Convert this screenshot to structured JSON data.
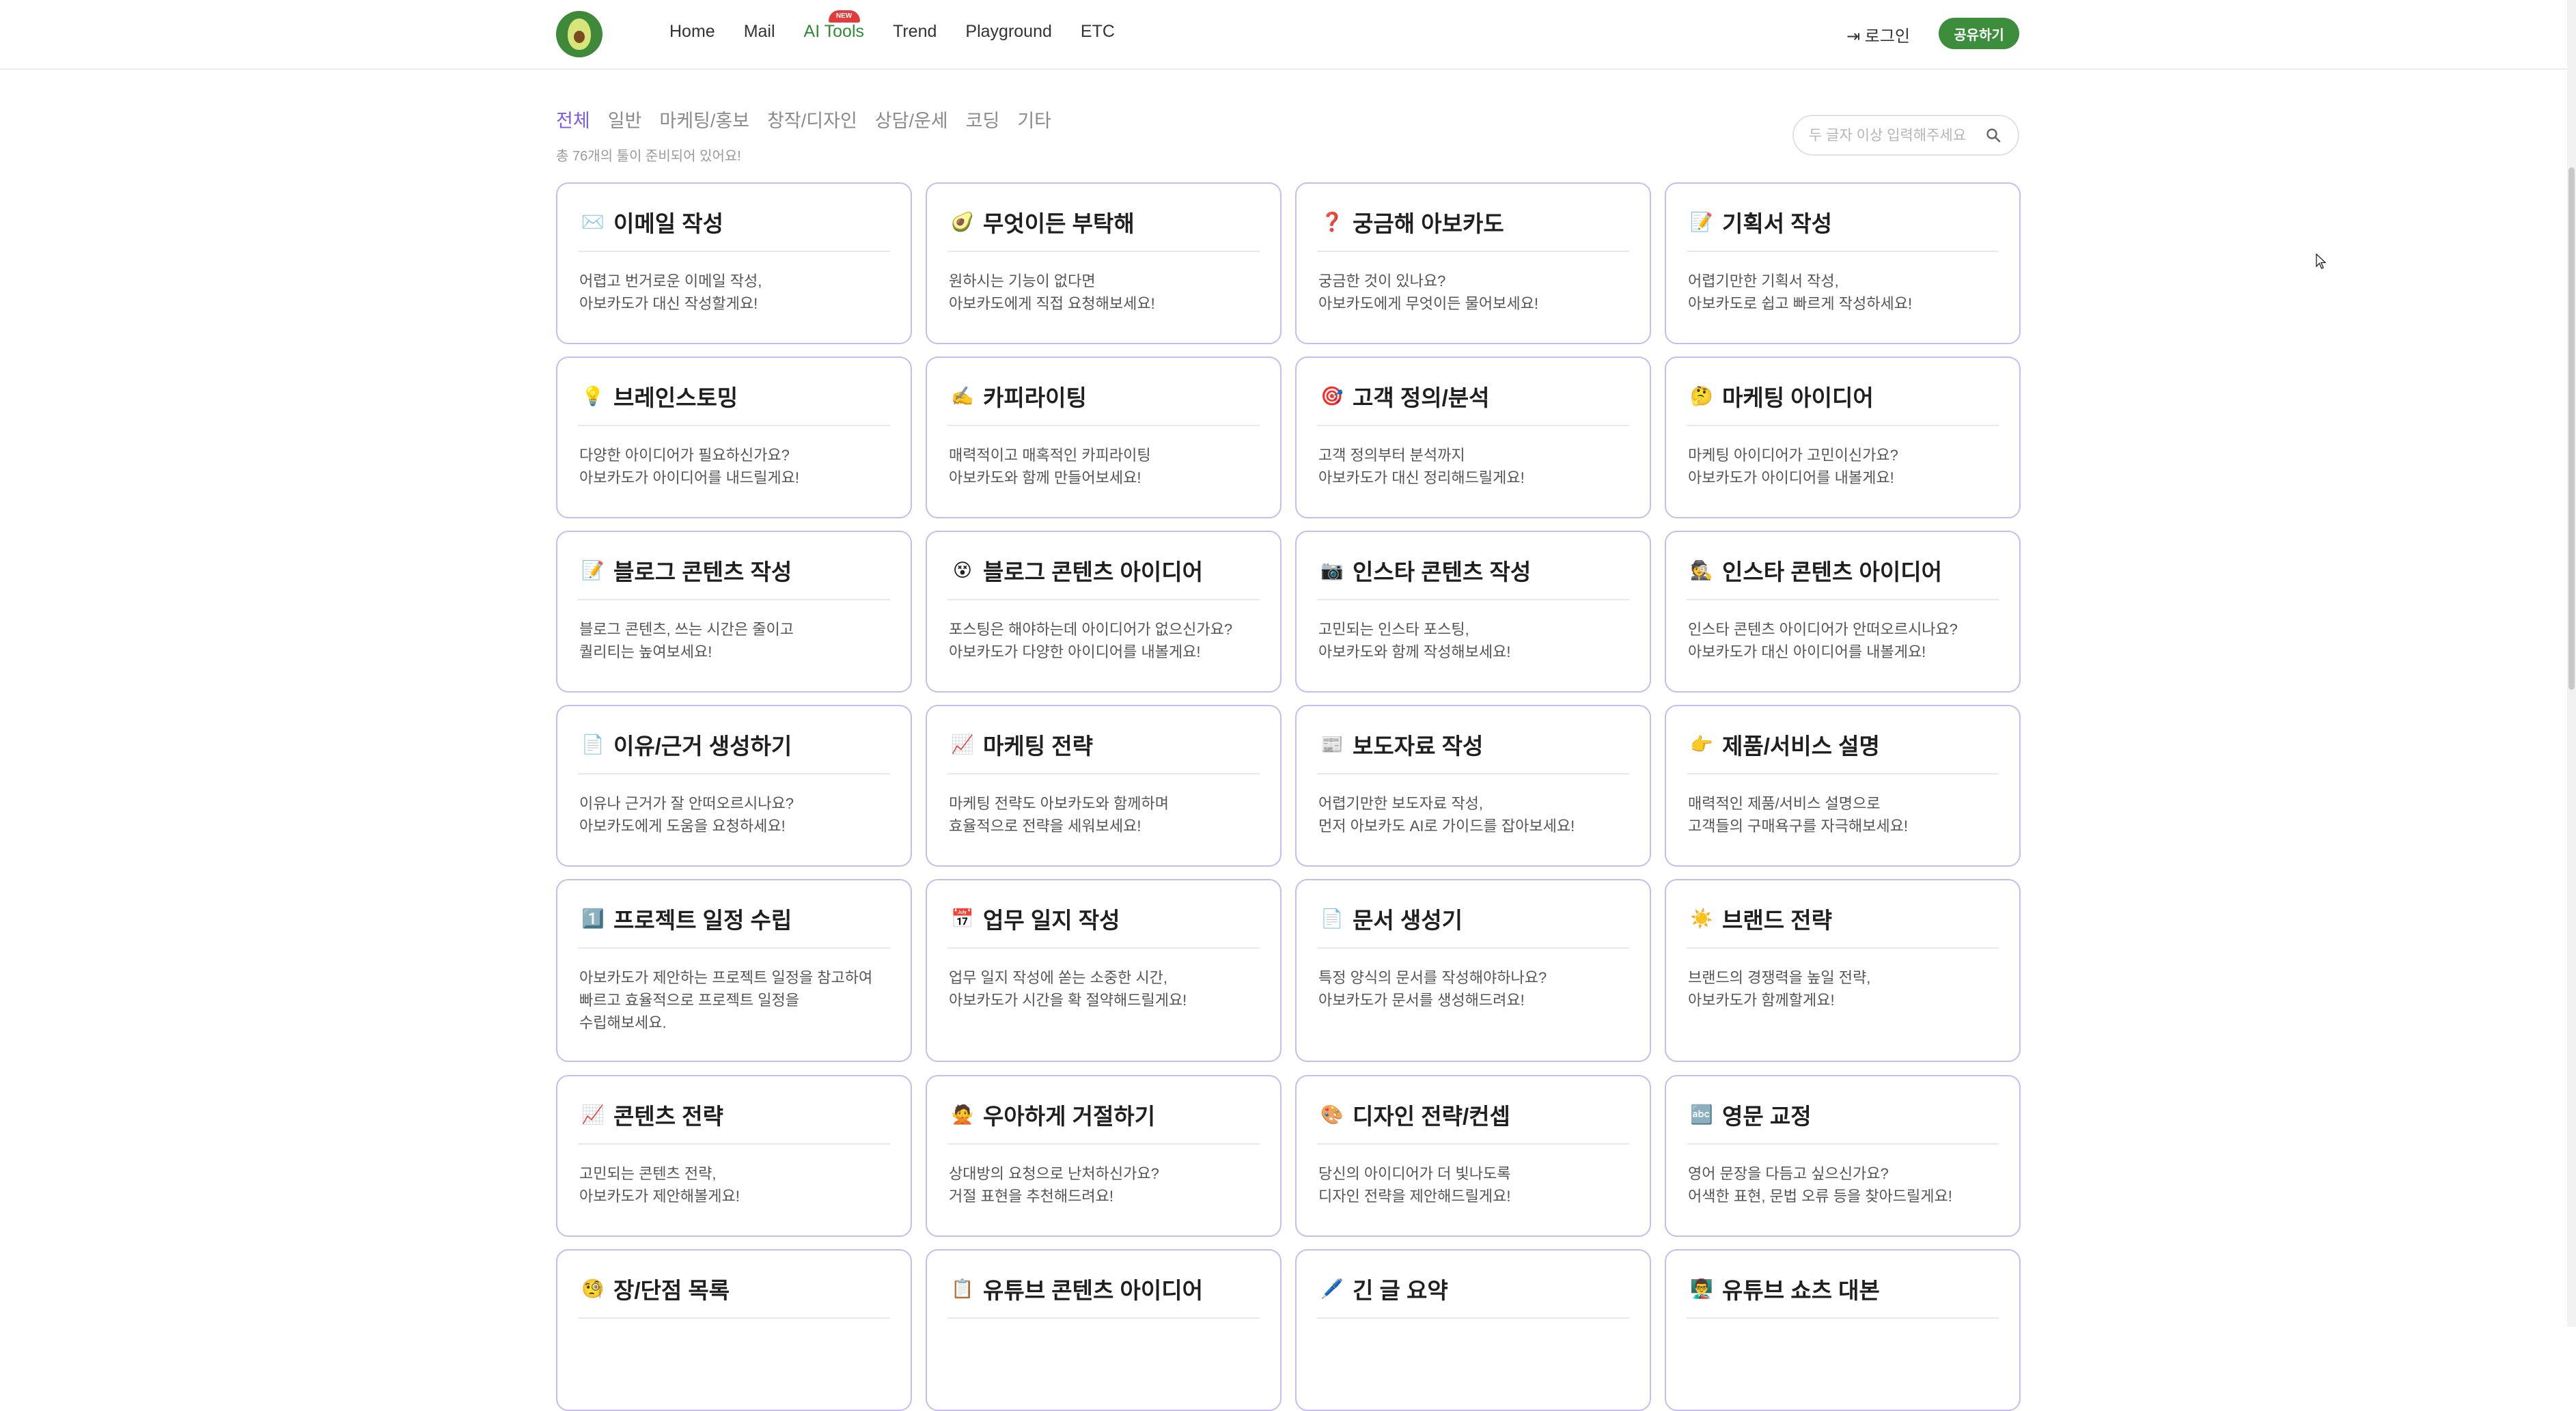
{
  "header": {
    "logo_alt": "avocado-logo",
    "nav": [
      {
        "label": "Home"
      },
      {
        "label": "Mail"
      },
      {
        "label": "AI Tools",
        "badge": "NEW"
      },
      {
        "label": "Trend"
      },
      {
        "label": "Playground"
      },
      {
        "label": "ETC"
      }
    ],
    "login": "⇥ 로그인",
    "share": "공유하기"
  },
  "filters": {
    "tabs": [
      "전체",
      "일반",
      "마케팅/홍보",
      "창작/디자인",
      "상담/운세",
      "코딩",
      "기타"
    ],
    "active": "전체",
    "count": "총 76개의 툴이 준비되어 있어요!"
  },
  "search": {
    "placeholder": "두 글자 이상 입력해주세요"
  },
  "accent": "#7b5cf0",
  "brand": "#3c8d3c",
  "cards": [
    {
      "icon": "✉️",
      "title": "이메일 작성",
      "desc": [
        "어렵고 번거로운 이메일 작성,",
        "아보카도가 대신 작성할게요!"
      ]
    },
    {
      "icon": "🥑",
      "title": "무엇이든 부탁해",
      "desc": [
        "원하시는 기능이 없다면",
        "아보카도에게 직접 요청해보세요!"
      ]
    },
    {
      "icon": "❓",
      "title": "궁금해 아보카도",
      "desc": [
        "궁금한 것이 있나요?",
        "아보카도에게 무엇이든 물어보세요!"
      ]
    },
    {
      "icon": "📝",
      "title": "기획서 작성",
      "desc": [
        "어렵기만한 기획서 작성,",
        "아보카도로 쉽고 빠르게 작성하세요!"
      ]
    },
    {
      "icon": "💡",
      "title": "브레인스토밍",
      "desc": [
        "다양한 아이디어가 필요하신가요?",
        "아보카도가 아이디어를 내드릴게요!"
      ]
    },
    {
      "icon": "✍️",
      "title": "카피라이팅",
      "desc": [
        "매력적이고 매혹적인 카피라이팅",
        "아보카도와 함께 만들어보세요!"
      ]
    },
    {
      "icon": "🎯",
      "title": "고객 정의/분석",
      "desc": [
        "고객 정의부터 분석까지",
        "아보카도가 대신 정리해드릴게요!"
      ]
    },
    {
      "icon": "🤔",
      "title": "마케팅 아이디어",
      "desc": [
        "마케팅 아이디어가 고민이신가요?",
        "아보카도가 아이디어를 내볼게요!"
      ]
    },
    {
      "icon": "📝",
      "title": "블로그 콘텐츠 작성",
      "desc": [
        "블로그 콘텐츠, 쓰는 시간은 줄이고",
        "퀄리티는 높여보세요!"
      ]
    },
    {
      "icon": "😵",
      "title": "블로그 콘텐츠 아이디어",
      "desc": [
        "포스팅은 해야하는데 아이디어가 없으신가요?",
        "아보카도가 다양한 아이디어를 내볼게요!"
      ]
    },
    {
      "icon": "📷",
      "title": "인스타 콘텐츠 작성",
      "desc": [
        "고민되는 인스타 포스팅,",
        "아보카도와 함께 작성해보세요!"
      ]
    },
    {
      "icon": "🕵️",
      "title": "인스타 콘텐츠 아이디어",
      "desc": [
        "인스타 콘텐츠 아이디어가 안떠오르시나요?",
        "아보카도가 대신 아이디어를 내볼게요!"
      ]
    },
    {
      "icon": "📄",
      "title": "이유/근거 생성하기",
      "desc": [
        "이유나 근거가 잘 안떠오르시나요?",
        "아보카도에게 도움을 요청하세요!"
      ]
    },
    {
      "icon": "📈",
      "title": "마케팅 전략",
      "desc": [
        "마케팅 전략도 아보카도와 함께하며",
        "효율적으로 전략을 세워보세요!"
      ]
    },
    {
      "icon": "📰",
      "title": "보도자료 작성",
      "desc": [
        "어렵기만한 보도자료 작성,",
        "먼저 아보카도 AI로 가이드를 잡아보세요!"
      ]
    },
    {
      "icon": "👉",
      "title": "제품/서비스 설명",
      "desc": [
        "매력적인 제품/서비스 설명으로",
        "고객들의 구매욕구를 자극해보세요!"
      ]
    },
    {
      "icon": "1️⃣",
      "title": "프로젝트 일정 수립",
      "desc": [
        "아보카도가 제안하는 프로젝트 일정을 참고하여",
        "빠르고 효율적으로 프로젝트 일정을",
        "수립해보세요."
      ]
    },
    {
      "icon": "📅",
      "title": "업무 일지 작성",
      "desc": [
        "업무 일지 작성에 쏟는 소중한 시간,",
        "아보카도가 시간을 확 절약해드릴게요!"
      ]
    },
    {
      "icon": "📄",
      "title": "문서 생성기",
      "desc": [
        "특정 양식의 문서를 작성해야하나요?",
        "아보카도가 문서를 생성해드려요!"
      ]
    },
    {
      "icon": "☀️",
      "title": "브랜드 전략",
      "desc": [
        "브랜드의 경쟁력을 높일 전략,",
        "아보카도가 함께할게요!"
      ]
    },
    {
      "icon": "📈",
      "title": "콘텐츠 전략",
      "desc": [
        "고민되는 콘텐츠 전략,",
        "아보카도가 제안해볼게요!"
      ]
    },
    {
      "icon": "🙅",
      "title": "우아하게 거절하기",
      "desc": [
        "상대방의 요청으로 난처하신가요?",
        "거절 표현을 추천해드려요!"
      ]
    },
    {
      "icon": "🎨",
      "title": "디자인 전략/컨셉",
      "desc": [
        "당신의 아이디어가 더 빛나도록",
        "디자인 전략을 제안해드릴게요!"
      ]
    },
    {
      "icon": "🔤",
      "title": "영문 교정",
      "desc": [
        "영어 문장을 다듬고 싶으신가요?",
        "어색한 표현, 문법 오류 등을 찾아드릴게요!"
      ]
    },
    {
      "icon": "🧐",
      "title": "장/단점 목록",
      "desc": []
    },
    {
      "icon": "📋",
      "title": "유튜브 콘텐츠 아이디어",
      "desc": []
    },
    {
      "icon": "🖊️",
      "title": "긴 글 요약",
      "desc": []
    },
    {
      "icon": "👨‍🏫",
      "title": "유튜브 쇼츠 대본",
      "desc": []
    }
  ]
}
